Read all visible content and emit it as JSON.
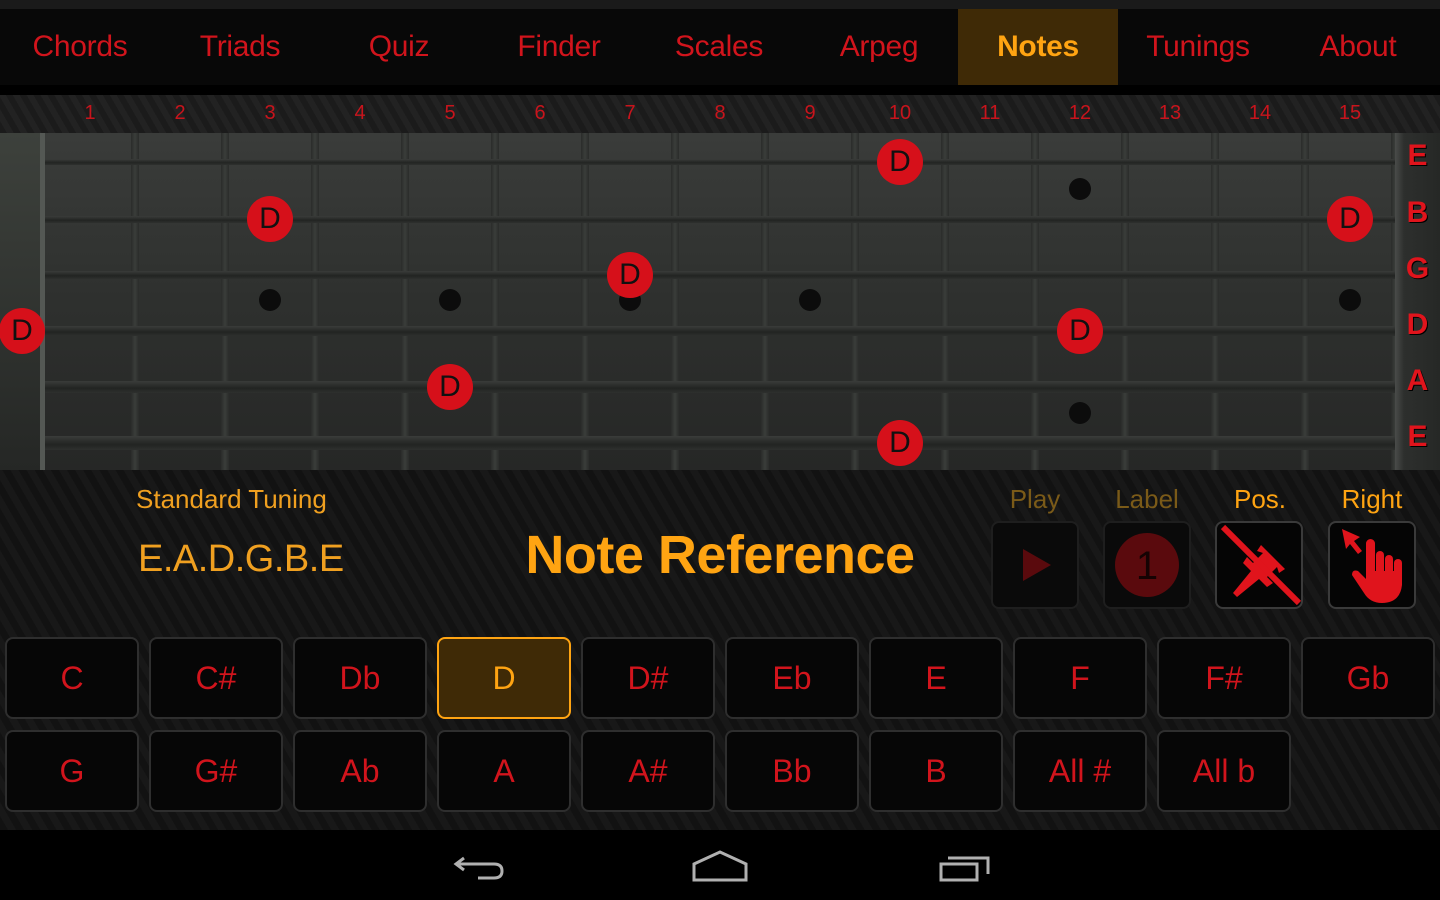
{
  "tabs": [
    {
      "label": "Chords",
      "active": false
    },
    {
      "label": "Triads",
      "active": false
    },
    {
      "label": "Quiz",
      "active": false
    },
    {
      "label": "Finder",
      "active": false
    },
    {
      "label": "Scales",
      "active": false
    },
    {
      "label": "Arpeg",
      "active": false
    },
    {
      "label": "Notes",
      "active": true
    },
    {
      "label": "Tunings",
      "active": false
    },
    {
      "label": "About",
      "active": false
    }
  ],
  "fret_numbers": [
    "1",
    "2",
    "3",
    "4",
    "5",
    "6",
    "7",
    "8",
    "9",
    "10",
    "11",
    "12",
    "13",
    "14",
    "15"
  ],
  "fretboard": {
    "strings": [
      "E",
      "B",
      "G",
      "D",
      "A",
      "E"
    ],
    "inlays": [
      {
        "fret": 3,
        "position": "center"
      },
      {
        "fret": 5,
        "position": "center"
      },
      {
        "fret": 7,
        "position": "center"
      },
      {
        "fret": 9,
        "position": "center"
      },
      {
        "fret": 12,
        "position": "double"
      },
      {
        "fret": 15,
        "position": "center"
      }
    ],
    "markers": [
      {
        "note": "D",
        "string": 1,
        "fret": 10
      },
      {
        "note": "D",
        "string": 2,
        "fret": 3
      },
      {
        "note": "D",
        "string": 2,
        "fret": 15
      },
      {
        "note": "D",
        "string": 3,
        "fret": 7
      },
      {
        "note": "D",
        "string": 4,
        "fret": 0
      },
      {
        "note": "D",
        "string": 4,
        "fret": 12
      },
      {
        "note": "D",
        "string": 5,
        "fret": 5
      },
      {
        "note": "D",
        "string": 6,
        "fret": 10
      }
    ]
  },
  "info": {
    "tuning_name": "Standard Tuning",
    "tuning_notes": "E.A.D.G.B.E",
    "title": "Note Reference"
  },
  "controls": [
    {
      "label": "Play",
      "icon": "play-icon",
      "enabled": false
    },
    {
      "label": "Label",
      "icon": "number-label-icon",
      "value": "1",
      "enabled": false
    },
    {
      "label": "Pos.",
      "icon": "pin-off-icon",
      "enabled": true
    },
    {
      "label": "Right",
      "icon": "hand-pointer-icon",
      "enabled": true
    }
  ],
  "note_buttons": {
    "row1": [
      "C",
      "C#",
      "Db",
      "D",
      "D#",
      "Eb",
      "E",
      "F",
      "F#",
      "Gb"
    ],
    "row2": [
      "G",
      "G#",
      "Ab",
      "A",
      "A#",
      "Bb",
      "B",
      "All #",
      "All b"
    ],
    "selected": "D"
  },
  "colors": {
    "accent": "#ffa412",
    "note_red": "#d1141c",
    "active_bg": "#3f2a06"
  },
  "navbar": [
    "back-icon",
    "home-icon",
    "recent-apps-icon"
  ]
}
